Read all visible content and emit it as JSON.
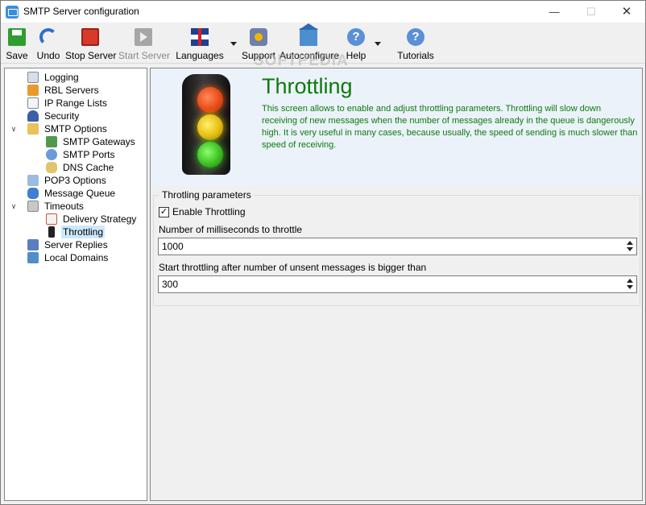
{
  "window": {
    "title": "SMTP Server configuration",
    "minimize_icon": "minimize-icon",
    "maximize_icon": "maximize-icon",
    "close_icon": "close-icon"
  },
  "toolbar": {
    "items": [
      {
        "label": "Save",
        "icon": "save-icon",
        "enabled": true
      },
      {
        "label": "Undo",
        "icon": "undo-icon",
        "enabled": true
      },
      {
        "label": "Stop Server",
        "icon": "stop-icon",
        "enabled": true
      },
      {
        "label": "Start Server",
        "icon": "start-icon",
        "enabled": false
      },
      {
        "label": "Languages",
        "icon": "uk-flag-icon",
        "enabled": true,
        "dropdown": true
      },
      {
        "label": "Support",
        "icon": "support-icon",
        "enabled": true
      },
      {
        "label": "Autoconfigure",
        "icon": "house-icon",
        "enabled": true
      },
      {
        "label": "Help",
        "icon": "help-icon",
        "enabled": true,
        "dropdown": true
      },
      {
        "label": "Tutorials",
        "icon": "help-icon",
        "enabled": true
      }
    ],
    "watermark": "SOFTPEDIA"
  },
  "tree": {
    "items": [
      {
        "label": "Logging",
        "level": 0,
        "icon": "log-icon"
      },
      {
        "label": "RBL Servers",
        "level": 0,
        "icon": "rbl-icon"
      },
      {
        "label": "IP Range Lists",
        "level": 0,
        "icon": "list-icon"
      },
      {
        "label": "Security",
        "level": 0,
        "icon": "user-icon"
      },
      {
        "label": "SMTP Options",
        "level": 0,
        "icon": "lock-folder-icon",
        "expanded": true
      },
      {
        "label": "SMTP Gateways",
        "level": 1,
        "icon": "gateway-icon"
      },
      {
        "label": "SMTP Ports",
        "level": 1,
        "icon": "ports-icon"
      },
      {
        "label": "DNS Cache",
        "level": 1,
        "icon": "database-icon"
      },
      {
        "label": "POP3 Options",
        "level": 0,
        "icon": "mail-icon"
      },
      {
        "label": "Message Queue",
        "level": 0,
        "icon": "queue-icon"
      },
      {
        "label": "Timeouts",
        "level": 0,
        "icon": "clock-icon",
        "expanded": true
      },
      {
        "label": "Delivery Strategy",
        "level": 1,
        "icon": "calendar-icon"
      },
      {
        "label": "Throttling",
        "level": 1,
        "icon": "traffic-light-icon",
        "selected": true
      },
      {
        "label": "Server Replies",
        "level": 0,
        "icon": "server-icon"
      },
      {
        "label": "Local Domains",
        "level": 0,
        "icon": "domain-icon"
      }
    ]
  },
  "main": {
    "title": "Throttling",
    "description": "This screen allows to enable and adjust throttling parameters. Throttling will slow down receiving of new messages when the number of messages already in the queue is dangerously high. It is very useful in many cases, because usually, the speed of sending is much slower than speed of receiving.",
    "group_title": "Throtling parameters",
    "enable_label": "Enable Throttling",
    "enable_checked": true,
    "field1_label": "Number of milliseconds to throttle",
    "field1_value": "1000",
    "field2_label": "Start throttling after number of unsent messages is bigger than",
    "field2_value": "300",
    "accent_color": "#0d7a0d"
  }
}
